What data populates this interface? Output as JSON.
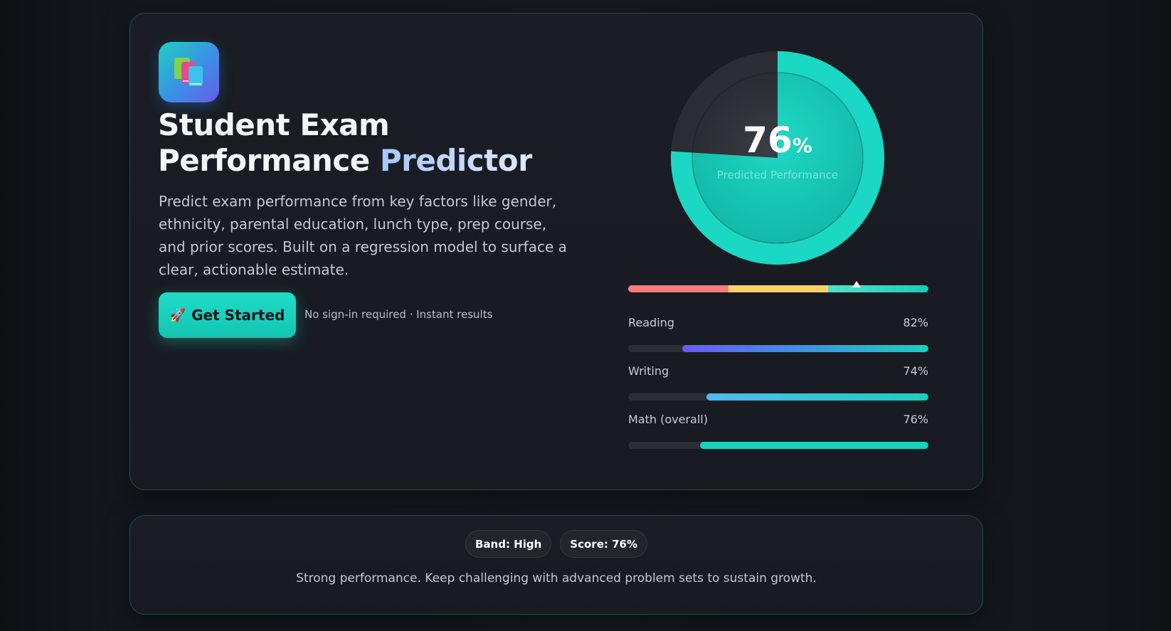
{
  "hero": {
    "title_line1": "Student Exam",
    "title_line2a": "Performance",
    "title_line2b": "Predictor",
    "description": "Predict exam performance from key factors like gender, ethnicity, parental education, lunch type, prep course, and prior scores. Built on a regression model to surface a clear, actionable estimate.",
    "cta_icon": "🚀",
    "cta_label": "Get Started",
    "cta_note": "No sign-in required · Instant results",
    "app_icon": "books-icon"
  },
  "gauge": {
    "value": 76,
    "value_text": "76",
    "unit": "%",
    "label": "Predicted Performance",
    "band_position": 0.76,
    "colors": {
      "fill": "#1ad8c4",
      "track": "#2a2e34",
      "low": "#ff7a7a",
      "mid": "#ffd166",
      "high": "#14cdb8"
    }
  },
  "metrics": [
    {
      "name": "Reading",
      "value_text": "82%",
      "value": 0.82
    },
    {
      "name": "Writing",
      "value_text": "74%",
      "value": 0.74
    },
    {
      "name": "Math (overall)",
      "value_text": "76%",
      "value": 0.76
    }
  ],
  "result": {
    "band_pill": "Band: High",
    "score_pill": "Score: 76%",
    "message": "Strong performance. Keep challenging with advanced problem sets to sustain growth."
  }
}
